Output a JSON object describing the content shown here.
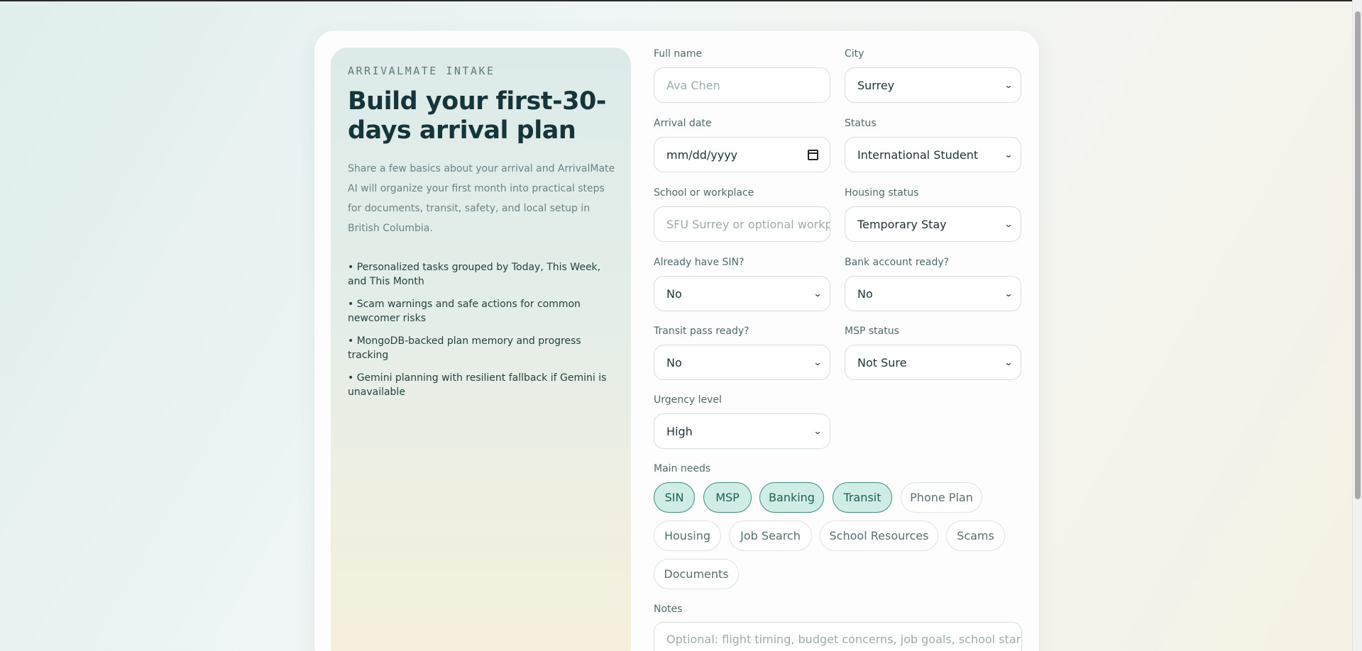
{
  "intro": {
    "eyebrow": "ARRIVALMATE INTAKE",
    "title": "Build your first-30-days arrival plan",
    "description": "Share a few basics about your arrival and ArrivalMate AI will organize your first month into practical steps for documents, transit, safety, and local setup in British Columbia.",
    "bullets": [
      "• Personalized tasks grouped by Today, This Week, and This Month",
      "• Scam warnings and safe actions for common newcomer risks",
      "• MongoDB-backed plan memory and progress tracking",
      "• Gemini planning with resilient fallback if Gemini is unavailable"
    ]
  },
  "form": {
    "full_name": {
      "label": "Full name",
      "placeholder": "Ava Chen"
    },
    "city": {
      "label": "City",
      "value": "Surrey"
    },
    "arrival_date": {
      "label": "Arrival date",
      "value": "mm/dd/yyyy"
    },
    "status": {
      "label": "Status",
      "value": "International Student"
    },
    "school": {
      "label": "School or workplace",
      "placeholder": "SFU Surrey or optional workp"
    },
    "housing": {
      "label": "Housing status",
      "value": "Temporary Stay"
    },
    "sin": {
      "label": "Already have SIN?",
      "value": "No"
    },
    "bank": {
      "label": "Bank account ready?",
      "value": "No"
    },
    "transit": {
      "label": "Transit pass ready?",
      "value": "No"
    },
    "msp": {
      "label": "MSP status",
      "value": "Not Sure"
    },
    "urgency": {
      "label": "Urgency level",
      "value": "High"
    },
    "needs": {
      "label": "Main needs",
      "chips": [
        {
          "label": "SIN",
          "selected": true
        },
        {
          "label": "MSP",
          "selected": true
        },
        {
          "label": "Banking",
          "selected": true
        },
        {
          "label": "Transit",
          "selected": true
        },
        {
          "label": "Phone Plan",
          "selected": false
        },
        {
          "label": "Housing",
          "selected": false
        },
        {
          "label": "Job Search",
          "selected": false
        },
        {
          "label": "School Resources",
          "selected": false
        },
        {
          "label": "Scams",
          "selected": false
        },
        {
          "label": "Documents",
          "selected": false
        }
      ]
    },
    "notes": {
      "label": "Notes",
      "placeholder": "Optional: flight timing, budget concerns, job goals, school start"
    }
  },
  "icons": {
    "select_arrow": "chevron-down-icon",
    "date_picker": "calendar-icon"
  },
  "colors": {
    "accent": "#3f8b7c",
    "chip_selected_bg": "#cfece6",
    "heading": "#15353a"
  }
}
